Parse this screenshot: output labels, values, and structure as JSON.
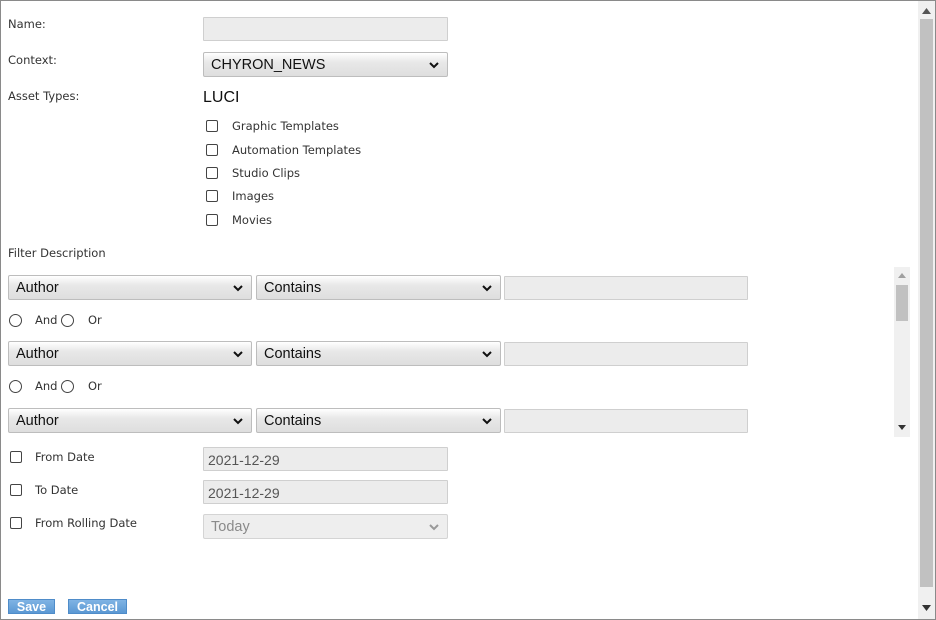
{
  "form": {
    "name": {
      "label": "Name:",
      "value": ""
    },
    "context": {
      "label": "Context:",
      "value": "CHYRON_NEWS"
    },
    "asset_types": {
      "label": "Asset Types:",
      "group": "LUCI",
      "options": [
        {
          "label": "Graphic Templates",
          "checked": false
        },
        {
          "label": "Automation Templates",
          "checked": false
        },
        {
          "label": "Studio Clips",
          "checked": false
        },
        {
          "label": "Images",
          "checked": false
        },
        {
          "label": "Movies",
          "checked": false
        }
      ]
    },
    "filter": {
      "label": "Filter Description",
      "rows": [
        {
          "field": "Author",
          "operator": "Contains",
          "value": ""
        },
        {
          "field": "Author",
          "operator": "Contains",
          "value": ""
        },
        {
          "field": "Author",
          "operator": "Contains",
          "value": ""
        }
      ],
      "conjunctions": [
        {
          "and_label": "And",
          "or_label": "Or"
        },
        {
          "and_label": "And",
          "or_label": "Or"
        }
      ]
    },
    "dates": {
      "from_date": {
        "label": "From Date",
        "value": "2021-12-29",
        "checked": false
      },
      "to_date": {
        "label": "To Date",
        "value": "2021-12-29",
        "checked": false
      },
      "from_rolling_date": {
        "label": "From Rolling Date",
        "value": "Today",
        "checked": false
      }
    }
  },
  "actions": {
    "save_label": "Save",
    "cancel_label": "Cancel"
  },
  "icons": {
    "dropdown": "chevron-down-icon",
    "scroll_up": "triangle-up-icon",
    "scroll_down": "triangle-down-icon"
  }
}
